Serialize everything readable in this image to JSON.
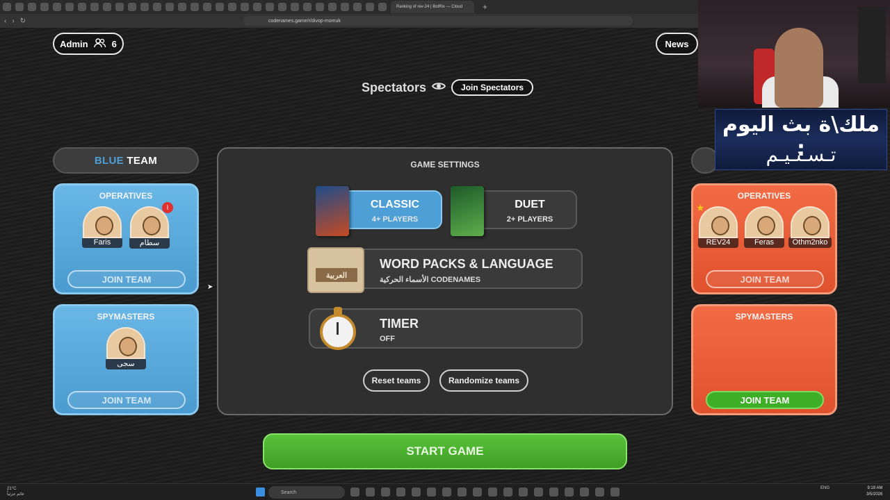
{
  "browser": {
    "active_tab_title": "Ranking of rev-24 | BotRix — Cloud",
    "url": "codenames.game/r/divop-momuk"
  },
  "header": {
    "admin_label": "Admin",
    "player_count": "6",
    "news_label": "News"
  },
  "spectators": {
    "title": "Spectators",
    "join_label": "Join Spectators"
  },
  "blue_team": {
    "header_prefix": "BLUE",
    "header_suffix": " TEAM",
    "operatives_title": "OPERATIVES",
    "operatives": [
      {
        "name": "Faris"
      },
      {
        "name": "سطام"
      }
    ],
    "operatives_join": "JOIN TEAM",
    "spymasters_title": "SPYMASTERS",
    "spymasters": [
      {
        "name": "سجى"
      }
    ],
    "spymasters_join": "JOIN TEAM"
  },
  "red_team": {
    "operatives_title": "OPERATIVES",
    "operatives": [
      {
        "name": "REV24"
      },
      {
        "name": "Feras"
      },
      {
        "name": "Othm2nko"
      }
    ],
    "operatives_join": "JOIN TEAM",
    "spymasters_title": "SPYMASTERS",
    "spymasters_join": "JOIN TEAM"
  },
  "settings": {
    "title": "GAME SETTINGS",
    "modes": [
      {
        "label": "CLASSIC",
        "sub": "4+ PLAYERS",
        "active": true
      },
      {
        "label": "DUET",
        "sub": "2+ PLAYERS",
        "active": false
      }
    ],
    "word_packs": {
      "title": "WORD PACKS & LANGUAGE",
      "sub": "الأسماء الحركية CODENAMES",
      "icon_text": "العربية"
    },
    "timer": {
      "title": "TIMER",
      "sub": "OFF"
    },
    "reset_label": "Reset teams",
    "randomize_label": "Randomize teams"
  },
  "start_label": "START GAME",
  "overlay": {
    "line1": "ملك\\ة بث اليوم :",
    "line2": "تـسـنـيـم"
  },
  "taskbar": {
    "weather_temp": "21°C",
    "weather_desc": "غائم جزئياً",
    "search_label": "Search",
    "lang": "ENG",
    "time": "9:19 AM",
    "date": "3/5/2026"
  },
  "colors": {
    "blue_team": "#4f9fd6",
    "red_team": "#e0512d",
    "start_green": "#3f9e26"
  }
}
